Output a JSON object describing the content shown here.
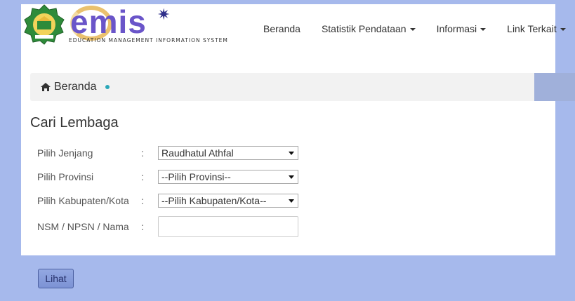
{
  "brand": {
    "wordmark": "emis",
    "tagline": "EDUCATION MANAGEMENT INFORMATION SYSTEM",
    "emblem_icon": "kemenag-emblem-icon"
  },
  "nav": {
    "items": [
      {
        "label": "Beranda",
        "dropdown": false
      },
      {
        "label": "Statistik Pendataan",
        "dropdown": true
      },
      {
        "label": "Informasi",
        "dropdown": true
      },
      {
        "label": "Link Terkait",
        "dropdown": true
      }
    ]
  },
  "breadcrumb": {
    "icon": "home-icon",
    "label": "Beranda"
  },
  "page": {
    "title": "Cari Lembaga"
  },
  "form": {
    "jenjang": {
      "label": "Pilih Jenjang",
      "colon": ":",
      "value": "Raudhatul Athfal"
    },
    "provinsi": {
      "label": "Pilih Provinsi",
      "colon": ":",
      "value": "--Pilih Provinsi--"
    },
    "kabupaten": {
      "label": "Pilih Kabupaten/Kota",
      "colon": ":",
      "value": "--Pilih Kabupaten/Kota--"
    },
    "nama": {
      "label": "NSM / NPSN / Nama",
      "colon": ":",
      "value": ""
    }
  },
  "actions": {
    "submit_label": "Lihat"
  },
  "colors": {
    "page_background": "#a6b9ec",
    "panel_background": "#ffffff",
    "breadcrumb_background": "#f2f2f2",
    "accent_dot": "#2aa7b8",
    "button_background": "#8aa0dc"
  }
}
